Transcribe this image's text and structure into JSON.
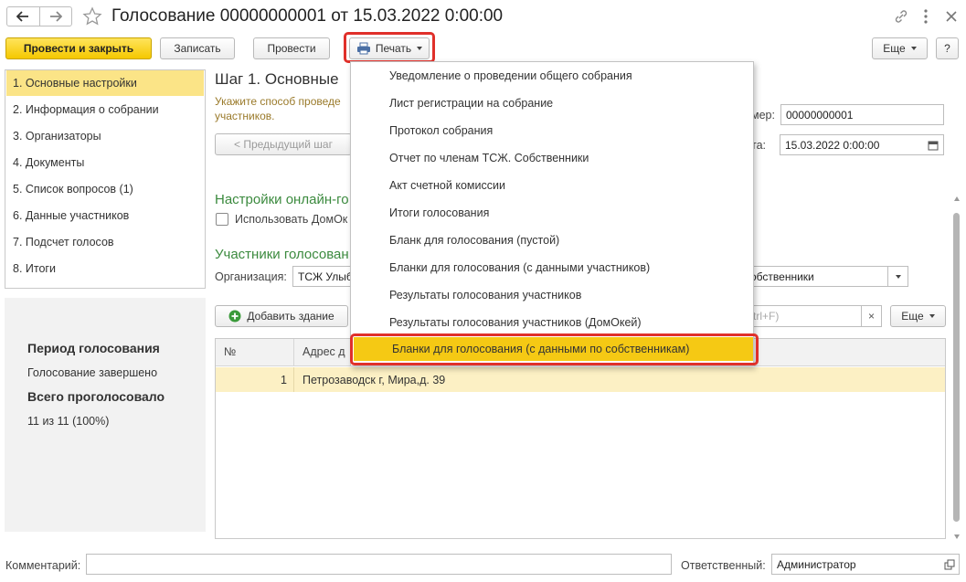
{
  "header": {
    "title": "Голосование 00000000001 от 15.03.2022 0:00:00"
  },
  "toolbar": {
    "post_close": "Провести и закрыть",
    "save": "Записать",
    "post": "Провести",
    "print": "Печать",
    "more": "Еще",
    "help": "?"
  },
  "sidebar": {
    "items": [
      {
        "label": "1. Основные настройки"
      },
      {
        "label": "2. Информация о собрании"
      },
      {
        "label": "3. Организаторы"
      },
      {
        "label": "4. Документы"
      },
      {
        "label": "5. Список вопросов (1)"
      },
      {
        "label": "6. Данные участников"
      },
      {
        "label": "7. Подсчет голосов"
      },
      {
        "label": "8. Итоги"
      }
    ]
  },
  "summary": {
    "period_title": "Период голосования",
    "period_status": "Голосование завершено",
    "total_title": "Всего проголосовало",
    "total_value": "11 из 11 (100%)"
  },
  "main": {
    "step_title": "Шаг 1. Основные",
    "hint_line1": "Укажите способ проведе",
    "hint_line2": "участников.",
    "prev_step": "< Предыдущий шаг",
    "number_label": "мер:",
    "number_value": "00000000001",
    "date_label": "та:",
    "date_value": "15.03.2022  0:00:00",
    "online_heading": "Настройки онлайн-го",
    "use_checkbox_label": "Использовать ДомОк",
    "participants_heading": "Участники голосован",
    "org_label": "Организация:",
    "org_value": "ТСЖ Улыб",
    "type_value": "обственники",
    "add_building": "Добавить здание",
    "search_placeholder": "trl+F)",
    "more2": "Еще",
    "table": {
      "headers": [
        "№",
        "Адрес д"
      ],
      "rows": [
        {
          "num": "1",
          "address": "Петрозаводск г, Мира,д. 39"
        }
      ]
    }
  },
  "print_menu": {
    "items": [
      {
        "label": "Уведомление о проведении общего собрания"
      },
      {
        "label": "Лист регистрации на собрание"
      },
      {
        "label": "Протокол собрания"
      },
      {
        "label": "Отчет по членам ТСЖ. Собственники"
      },
      {
        "label": "Акт счетной комиссии"
      },
      {
        "label": "Итоги голосования"
      },
      {
        "label": "Бланк для голосования (пустой)"
      },
      {
        "label": "Бланки для голосования (с данными участников)"
      },
      {
        "label": "Результаты голосования участников"
      },
      {
        "label": "Результаты голосования участников (ДомОкей)"
      },
      {
        "label": "Бланки для голосования (с данными по собственникам)"
      }
    ]
  },
  "footer": {
    "comment_label": "Комментарий:",
    "comment_value": "",
    "responsible_label": "Ответственный:",
    "responsible_value": "Администратор"
  },
  "colors": {
    "accent_yellow": "#f5c914",
    "highlight_red": "#e0302a",
    "heading_green": "#3b8a3e",
    "active_row": "#fcf0c4"
  }
}
